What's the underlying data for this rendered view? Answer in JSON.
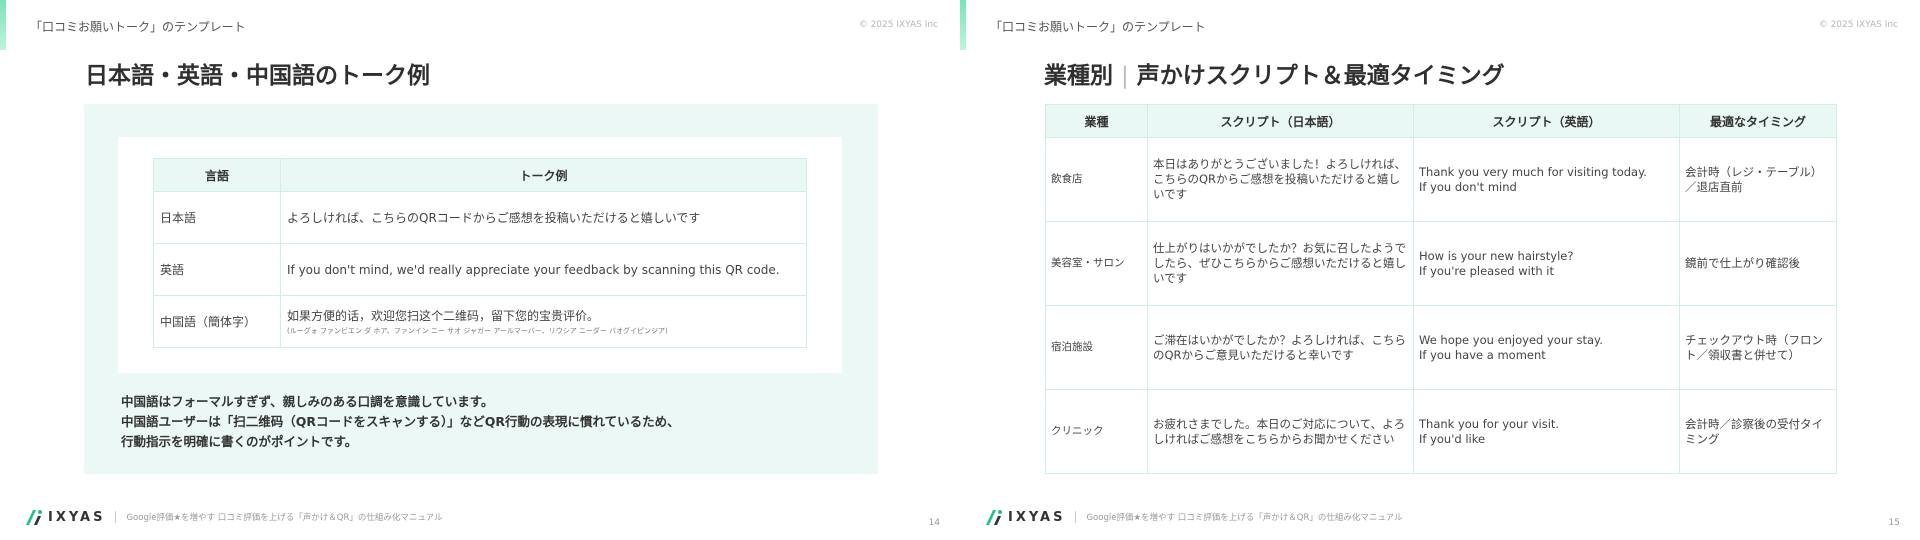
{
  "left": {
    "header_title": "「口コミお願いトーク」のテンプレート",
    "copyright": "© 2025 IXYAS Inc",
    "heading": "日本語・英語・中国語のトーク例",
    "table": {
      "headers": [
        "言語",
        "トーク例"
      ],
      "rows": [
        {
          "lang": "日本語",
          "talk": "よろしければ、こちらのQRコードからご感想を投稿いただけると嬉しいです",
          "sub": ""
        },
        {
          "lang": "英語",
          "talk": "If you don't mind, we'd really appreciate your feedback by scanning this QR code.",
          "sub": ""
        },
        {
          "lang": "中国語（簡体字）",
          "talk": "如果方便的话，欢迎您扫这个二维码，留下您的宝贵评价。",
          "sub": "(ルーグォ ファンビエン ダ ホア、ファンイン ニー サオ ジャガー アールマーバー、リウシア ニーダー バオグイピンジア)"
        }
      ]
    },
    "notes": [
      "中国語はフォーマルすぎず、親しみのある口調を意識しています。",
      "中国語ユーザーは「扫二维码（QRコードをスキャンする）」などQR行動の表現に慣れているため、",
      "行動指示を明確に書くのがポイントです。"
    ],
    "footer": {
      "logo": "IXYAS",
      "text": "Google評価★を増やす 口コミ評価を上げる「声かけ＆QR」の仕組み化マニュアル"
    },
    "page": "14"
  },
  "right": {
    "header_title": "「口コミお願いトーク」のテンプレート",
    "copyright": "© 2025 IXYAS Inc",
    "heading_a": "業種別",
    "heading_b": "声かけスクリプト＆最適タイミング",
    "table": {
      "headers": [
        "業種",
        "スクリプト（日本語）",
        "スクリプト（英語）",
        "最適なタイミング"
      ],
      "rows": [
        {
          "industry": "飲食店",
          "ja": "本日はありがとうございました！よろしければ、こちらのQRからご感想を投稿いただけると嬉しいです",
          "en1": "Thank you very much for visiting today.",
          "en2": "If you don't mind",
          "timing": "会計時（レジ・テーブル）／退店直前"
        },
        {
          "industry": "美容室・サロン",
          "ja": "仕上がりはいかがでしたか？お気に召したようでしたら、ぜひこちらからご感想いただけると嬉しいです",
          "en1": "How is your new hairstyle?",
          "en2": "If you're pleased with it",
          "timing": "鏡前で仕上がり確認後"
        },
        {
          "industry": "宿泊施設",
          "ja": "ご滞在はいかがでしたか？よろしければ、こちらのQRからご意見いただけると幸いです",
          "en1": "We hope you enjoyed your stay.",
          "en2": "If you have a moment",
          "timing": "チェックアウト時（フロント／領収書と併せて）"
        },
        {
          "industry": "クリニック",
          "ja": "お疲れさまでした。本日のご対応について、よろしければご感想をこちらからお聞かせください",
          "en1": "Thank you for your visit.",
          "en2": "If you'd like",
          "timing": "会計時／診察後の受付タイミング"
        }
      ]
    },
    "footer": {
      "logo": "IXYAS",
      "text": "Google評価★を増やす 口コミ評価を上げる「声かけ＆QR」の仕組み化マニュアル"
    },
    "page": "15"
  }
}
